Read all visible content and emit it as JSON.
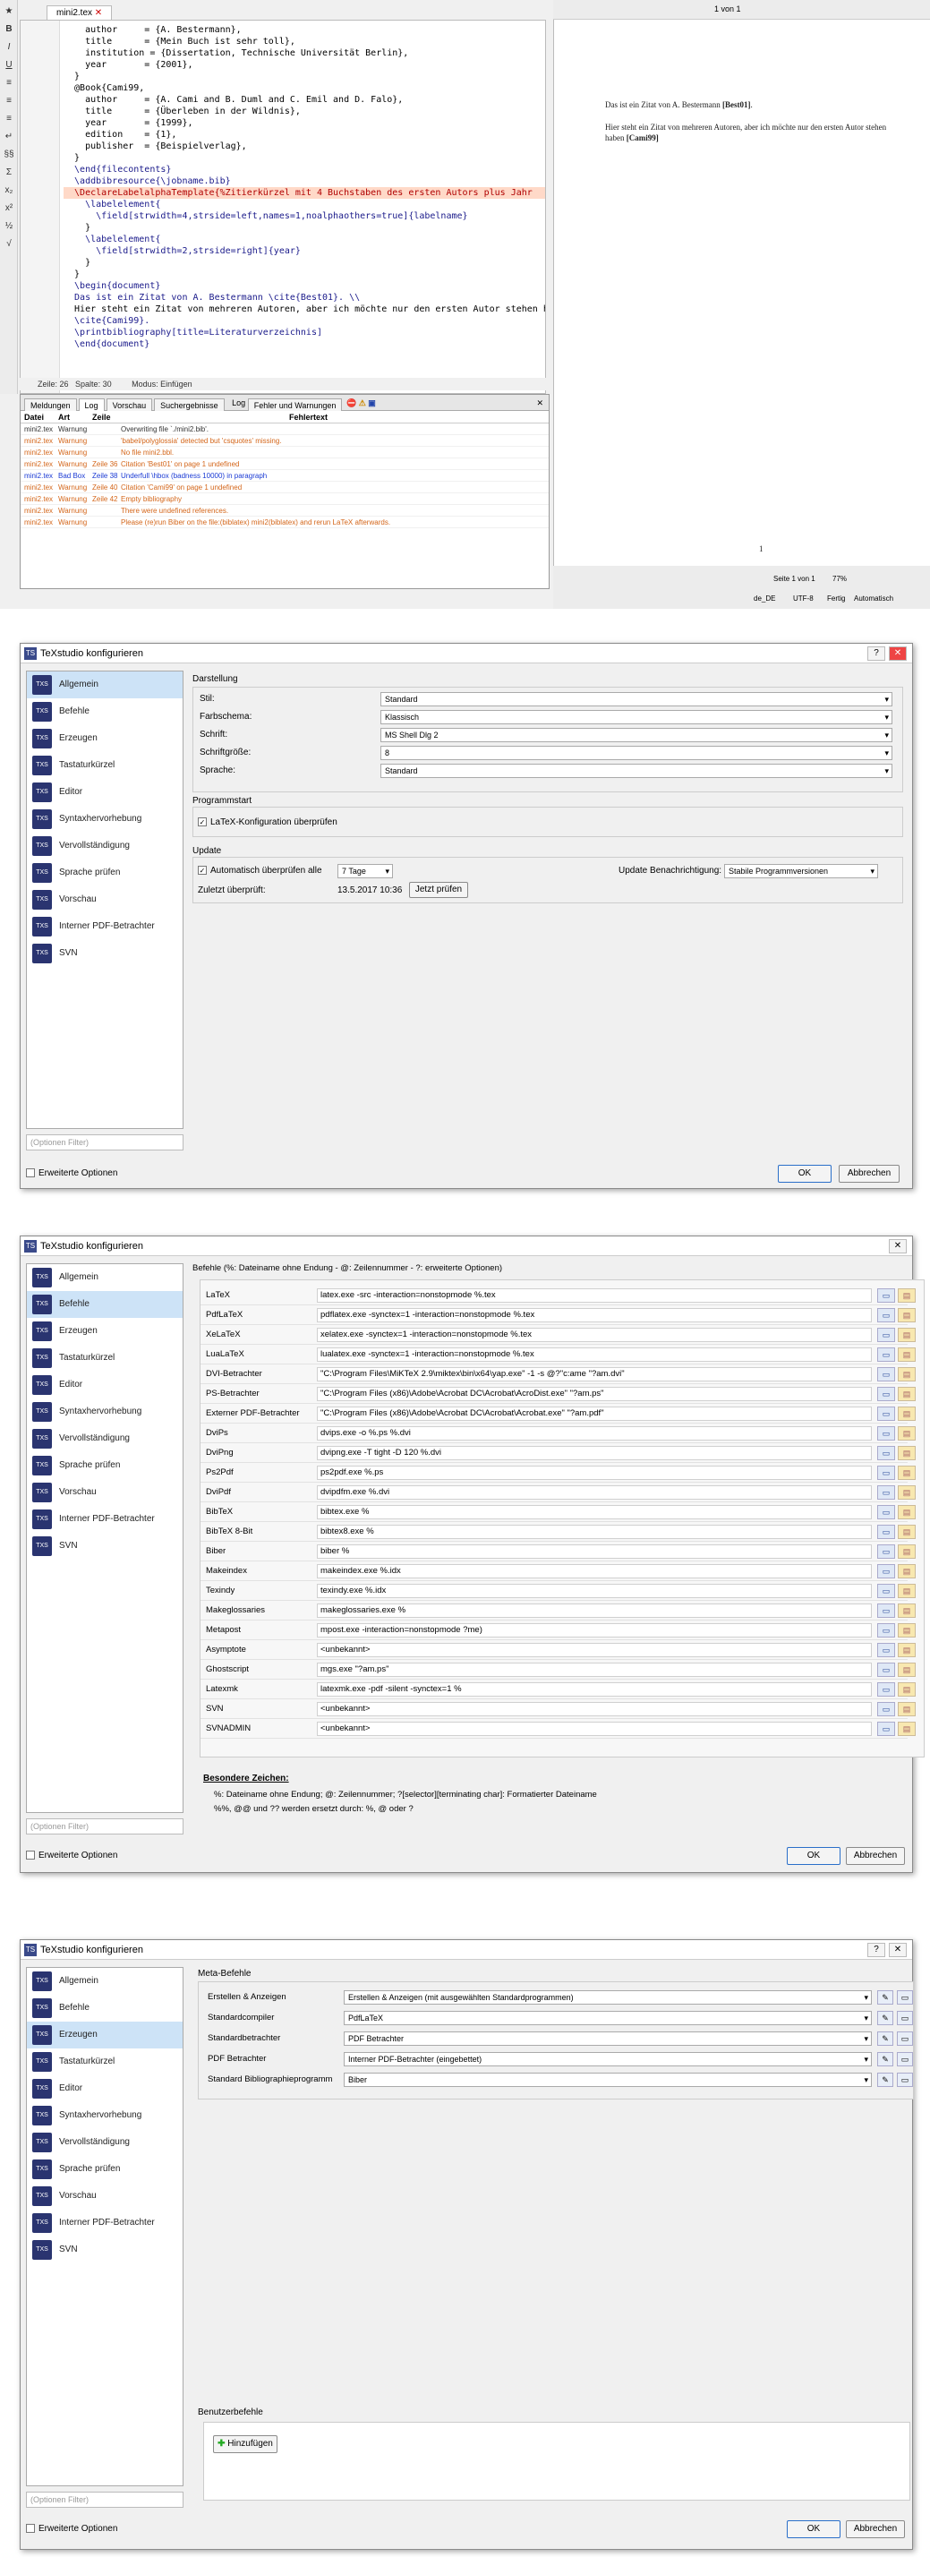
{
  "editor": {
    "tab": "mini2.tex",
    "lines": [
      "    author     = {A. Bestermann},",
      "    title      = {Mein Buch ist sehr toll},",
      "    institution = {Dissertation, Technische Universität Berlin},",
      "    year       = {2001},",
      "  }",
      "",
      "  @Book{Cami99,",
      "    author     = {A. Cami and B. Duml and C. Emil and D. Falo},",
      "    title      = {Überleben in der Wildnis},",
      "    year       = {1999},",
      "    edition    = {1},",
      "    publisher  = {Beispielverlag},",
      "  }",
      "  \\end{filecontents}",
      "",
      "  \\addbibresource{\\jobname.bib}",
      "",
      "  \\DeclareLabelalphaTemplate{%Zitierkürzel mit 4 Buchstaben des ersten Autors plus Jahr",
      "    \\labelelement{",
      "      \\field[strwidth=4,strside=left,names=1,noalphaothers=true]{labelname}",
      "    }",
      "    \\labelelement{",
      "      \\field[strwidth=2,strside=right]{year}",
      "    }",
      "  }",
      "",
      "  \\begin{document}",
      "  Das ist ein Zitat von A. Bestermann \\cite{Best01}. \\\\",
      "",
      "  Hier steht ein Zitat von mehreren Autoren, aber ich möchte nur den ersten Autor stehen haben",
      "  \\cite{Cami99}.",
      "",
      "  \\printbibliography[title=Literaturverzeichnis]",
      "  \\end{document}"
    ],
    "status_line": "Zeile: 26",
    "status_col": "Spalte: 30",
    "status_mode": "Modus: Einfügen"
  },
  "log": {
    "tabs": [
      "Meldungen",
      "Log",
      "Vorschau",
      "Suchergebnisse"
    ],
    "tab_log": "Log",
    "filter_label": "Fehler und Warnungen",
    "headers": [
      "Datei",
      "Art",
      "Zeile",
      "Fehlertext"
    ],
    "rows": [
      {
        "file": "mini2.tex",
        "kind": "Warnung",
        "line": "",
        "text": "Overwriting file `./mini2.bib'.",
        "cls": "info"
      },
      {
        "file": "mini2.tex",
        "kind": "Warnung",
        "line": "",
        "text": "'babel/polyglossia' detected but 'csquotes' missing.",
        "cls": "warn"
      },
      {
        "file": "mini2.tex",
        "kind": "Warnung",
        "line": "",
        "text": "No file mini2.bbl.",
        "cls": "warn"
      },
      {
        "file": "mini2.tex",
        "kind": "Warnung",
        "line": "Zeile 36",
        "text": "Citation 'Best01' on page 1 undefined",
        "cls": "warn"
      },
      {
        "file": "mini2.tex",
        "kind": "Bad Box",
        "line": "Zeile 38",
        "text": "Underfull \\hbox (badness 10000) in paragraph",
        "cls": "bad"
      },
      {
        "file": "mini2.tex",
        "kind": "Warnung",
        "line": "Zeile 40",
        "text": "Citation 'Cami99' on page 1 undefined",
        "cls": "warn"
      },
      {
        "file": "mini2.tex",
        "kind": "Warnung",
        "line": "Zeile 42",
        "text": "Empty bibliography",
        "cls": "warn"
      },
      {
        "file": "mini2.tex",
        "kind": "Warnung",
        "line": "",
        "text": "There were undefined references.",
        "cls": "warn"
      },
      {
        "file": "mini2.tex",
        "kind": "Warnung",
        "line": "",
        "text": "Please (re)run Biber on the file:(biblatex) mini2(biblatex) and rerun LaTeX afterwards.",
        "cls": "warn"
      }
    ]
  },
  "pdf": {
    "page_label": "1 von 1",
    "text1_a": "Das ist ein Zitat von A. Bestermann ",
    "text1_b": "[Best01]",
    "text1_c": ".",
    "text2_a": "Hier steht ein Zitat von mehreren Autoren, aber ich möchte nur den ersten Autor stehen",
    "text2_b": "haben ",
    "text2_c": "[Cami99]",
    "page_num": "1",
    "page_status": "Seite 1 von 1",
    "zoom": "77%",
    "lang": "de_DE",
    "enc": "UTF-8",
    "ready": "Fertig",
    "auto": "Automatisch"
  },
  "dialog": {
    "title": "TeXstudio konfigurieren",
    "help": "?",
    "close": "✕",
    "filter_placeholder": "(Optionen Filter)",
    "advanced": "Erweiterte Optionen",
    "ok": "OK",
    "cancel": "Abbrechen",
    "nav": [
      {
        "label": "Allgemein",
        "icon": "general-icon"
      },
      {
        "label": "Befehle",
        "icon": "commands-icon"
      },
      {
        "label": "Erzeugen",
        "icon": "build-icon"
      },
      {
        "label": "Tastaturkürzel",
        "icon": "shortcuts-icon"
      },
      {
        "label": "Editor",
        "icon": "editor-icon"
      },
      {
        "label": "Syntaxhervorhebung",
        "icon": "syntax-icon"
      },
      {
        "label": "Vervollständigung",
        "icon": "completion-icon"
      },
      {
        "label": "Sprache prüfen",
        "icon": "spellcheck-icon"
      },
      {
        "label": "Vorschau",
        "icon": "preview-icon"
      },
      {
        "label": "Interner PDF-Betrachter",
        "icon": "pdf-viewer-icon"
      },
      {
        "label": "SVN",
        "icon": "svn-icon"
      }
    ]
  },
  "general": {
    "section_display": "Darstellung",
    "rows": [
      {
        "label": "Stil:",
        "value": "Standard"
      },
      {
        "label": "Farbschema:",
        "value": "Klassisch"
      },
      {
        "label": "Schrift:",
        "value": "MS Shell Dlg 2"
      },
      {
        "label": "Schriftgröße:",
        "value": "8"
      },
      {
        "label": "Sprache:",
        "value": "Standard"
      }
    ],
    "section_start": "Programmstart",
    "check_latex": "LaTeX-Konfiguration überprüfen",
    "section_update": "Update",
    "auto_check": "Automatisch überprüfen alle",
    "days": "7 Tage",
    "notif_label": "Update Benachrichtigung:",
    "notif_value": "Stabile Programmversionen",
    "last_label": "Zuletzt überprüft:",
    "last_value": "13.5.2017 10:36",
    "check_now": "Jetzt prüfen"
  },
  "commands": {
    "header": "Befehle (%: Dateiname ohne Endung - @: Zeilennummer - ?: erweiterte Optionen)",
    "rows": [
      {
        "label": "LaTeX",
        "value": "latex.exe -src -interaction=nonstopmode %.tex"
      },
      {
        "label": "PdfLaTeX",
        "value": "pdflatex.exe -synctex=1 -interaction=nonstopmode %.tex"
      },
      {
        "label": "XeLaTeX",
        "value": "xelatex.exe -synctex=1 -interaction=nonstopmode %.tex"
      },
      {
        "label": "LuaLaTeX",
        "value": "lualatex.exe -synctex=1 -interaction=nonstopmode %.tex"
      },
      {
        "label": "DVI-Betrachter",
        "value": "\"C:\\Program Files\\MiKTeX 2.9\\miktex\\bin\\x64\\yap.exe\" -1 -s @?\"c:ame \"?am.dvi\""
      },
      {
        "label": "PS-Betrachter",
        "value": "\"C:\\Program Files (x86)\\Adobe\\Acrobat DC\\Acrobat\\AcroDist.exe\" \"?am.ps\""
      },
      {
        "label": "Externer PDF-Betrachter",
        "value": "\"C:\\Program Files (x86)\\Adobe\\Acrobat DC\\Acrobat\\Acrobat.exe\" \"?am.pdf\""
      },
      {
        "label": "DviPs",
        "value": "dvips.exe -o %.ps %.dvi"
      },
      {
        "label": "DviPng",
        "value": "dvipng.exe -T tight -D 120 %.dvi"
      },
      {
        "label": "Ps2Pdf",
        "value": "ps2pdf.exe %.ps"
      },
      {
        "label": "DviPdf",
        "value": "dvipdfm.exe %.dvi"
      },
      {
        "label": "BibTeX",
        "value": "bibtex.exe %"
      },
      {
        "label": "BibTeX 8-Bit",
        "value": "bibtex8.exe %"
      },
      {
        "label": "Biber",
        "value": "biber %"
      },
      {
        "label": "Makeindex",
        "value": "makeindex.exe %.idx"
      },
      {
        "label": "Texindy",
        "value": "texindy.exe %.idx"
      },
      {
        "label": "Makeglossaries",
        "value": "makeglossaries.exe %"
      },
      {
        "label": "Metapost",
        "value": "mpost.exe -interaction=nonstopmode ?me)"
      },
      {
        "label": "Asymptote",
        "value": "<unbekannt>"
      },
      {
        "label": "Ghostscript",
        "value": "mgs.exe \"?am.ps\""
      },
      {
        "label": "Latexmk",
        "value": "latexmk.exe -pdf -silent -synctex=1 %"
      },
      {
        "label": "SVN",
        "value": "<unbekannt>"
      },
      {
        "label": "SVNADMIN",
        "value": "<unbekannt>"
      }
    ],
    "special_title": "Besondere Zeichen:",
    "special_1": "%: Dateiname ohne Endung; @: Zeilennummer; ?[selector][terminating char]: Formatierter Dateiname",
    "special_2": "%%, @@ und ?? werden ersetzt durch: %, @ oder ?"
  },
  "build": {
    "meta_title": "Meta-Befehle",
    "rows": [
      {
        "label": "Erstellen & Anzeigen",
        "value": "Erstellen & Anzeigen (mit ausgewählten Standardprogrammen)"
      },
      {
        "label": "Standardcompiler",
        "value": "PdfLaTeX"
      },
      {
        "label": "Standardbetrachter",
        "value": "PDF Betrachter"
      },
      {
        "label": "PDF Betrachter",
        "value": "Interner PDF-Betrachter (eingebettet)"
      },
      {
        "label": "Standard Bibliographieprogramm",
        "value": "Biber"
      }
    ],
    "user_title": "Benutzerbefehle",
    "add": "Hinzufügen"
  }
}
